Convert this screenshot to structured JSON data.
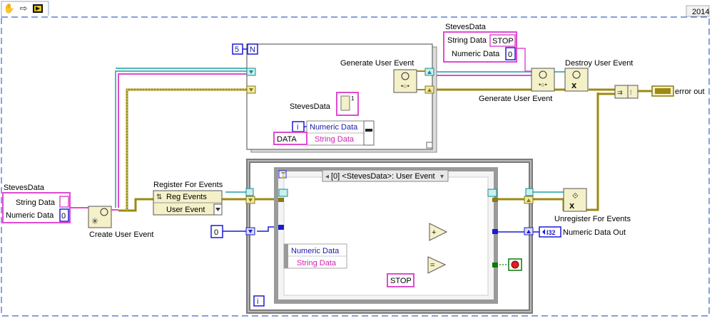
{
  "toolbar": {
    "items": [
      {
        "name": "hand-tool-icon"
      },
      {
        "name": "arrow-tool-icon"
      },
      {
        "name": "vi-icon"
      }
    ]
  },
  "version": "2014",
  "top_cluster": {
    "title": "StevesData",
    "field1_label": "String Data",
    "field1_value": "STOP",
    "field2_label": "Numeric Data",
    "field2_value": "0"
  },
  "left_cluster": {
    "title": "StevesData",
    "field1_label": "String Data",
    "field1_value": "",
    "field2_label": "Numeric Data",
    "field2_value": "0"
  },
  "loop_count": {
    "value": "5",
    "terminal": "N"
  },
  "labels": {
    "generate_user_event_inner": "Generate User Event",
    "generate_user_event_outer": "Generate User Event",
    "destroy_user_event": "Destroy User Event",
    "create_user_event": "Create User Event",
    "register_for_events": "Register For Events",
    "reg_events": "Reg Events",
    "user_event": "User Event",
    "unregister_for_events": "Unregister For Events",
    "error_out": "error out",
    "numeric_data_out": "Numeric Data Out",
    "bundle_title": "StevesData",
    "bundle_numeric": "Numeric Data",
    "bundle_string": "String Data",
    "data_const": "DATA",
    "iter_terminal": "i",
    "event_selector": "[0] <StevesData>: User Event",
    "unbundle_numeric": "Numeric Data",
    "unbundle_string": "String Data",
    "stop_const": "STOP",
    "init_const": "0",
    "i32_label": "I32",
    "while_iter": "i",
    "bundle_counter": "1"
  },
  "colors": {
    "frame": "#3a68c8",
    "string_wire": "#e04bd0",
    "numeric_wire": "#1b1bd6",
    "error_wire": "#9c8a12",
    "event_wire": "#10a0a0",
    "refnum_wire": "#2f8f8f",
    "bool_wire": "#0a7a0a"
  }
}
